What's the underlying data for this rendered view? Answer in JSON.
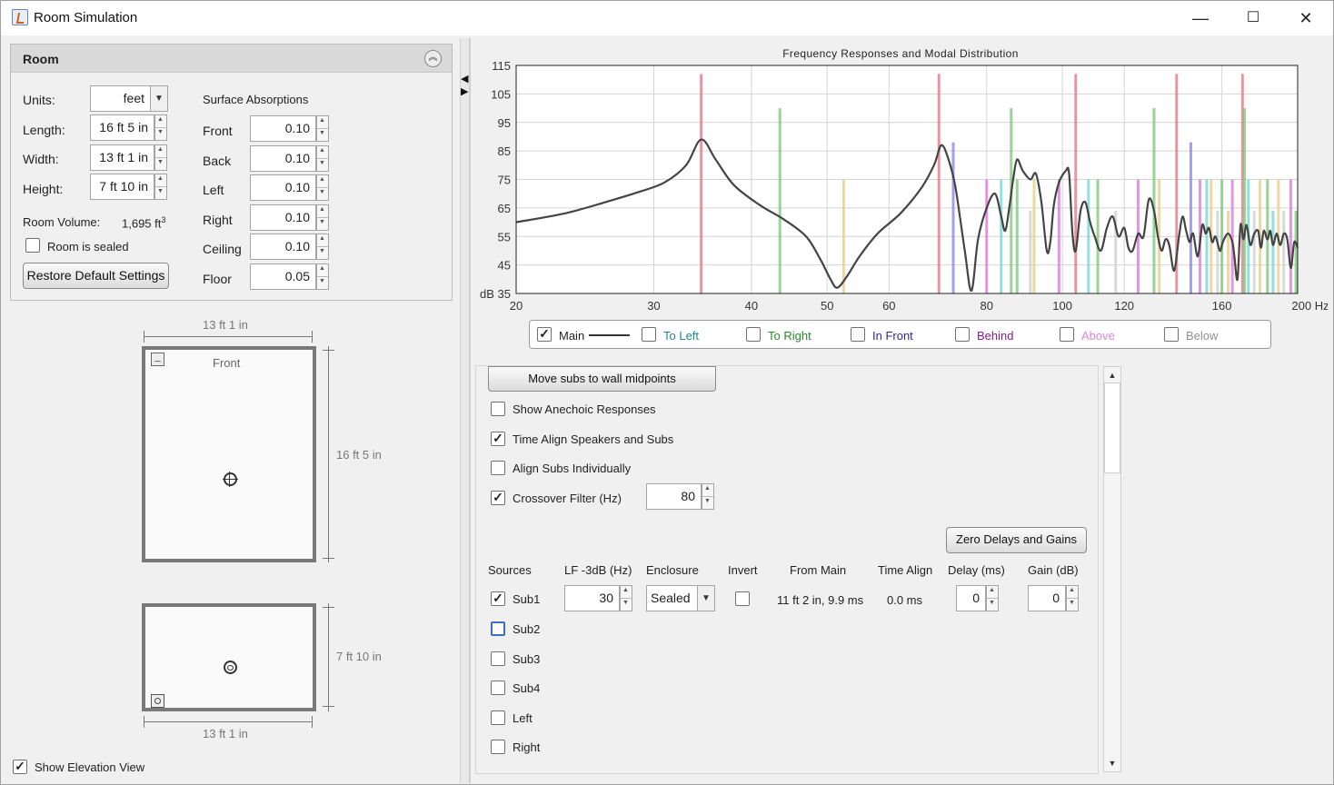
{
  "window": {
    "title": "Room Simulation",
    "minimize": "—",
    "maximize": "☐",
    "close": "✕"
  },
  "room": {
    "title": "Room",
    "units_label": "Units:",
    "units_value": "feet",
    "length_label": "Length:",
    "length_value": "16 ft 5 in",
    "width_label": "Width:",
    "width_value": "13 ft 1 in",
    "height_label": "Height:",
    "height_value": "7 ft 10 in",
    "volume_label": "Room Volume:",
    "volume_value": "1,695 ft",
    "volume_exp": "3",
    "sealed_label": "Room is sealed",
    "sealed_checked": false,
    "restore_label": "Restore Default Settings",
    "absorptions_title": "Surface Absorptions",
    "absorptions": [
      {
        "label": "Front",
        "value": "0.10"
      },
      {
        "label": "Back",
        "value": "0.10"
      },
      {
        "label": "Left",
        "value": "0.10"
      },
      {
        "label": "Right",
        "value": "0.10"
      },
      {
        "label": "Ceiling",
        "value": "0.10"
      },
      {
        "label": "Floor",
        "value": "0.05"
      }
    ]
  },
  "plan": {
    "top_dim": "13 ft 1 in",
    "side_dim": "16 ft 5 in",
    "front_label": "Front"
  },
  "elevation": {
    "side_dim": "7 ft 10 in",
    "bottom_dim": "13 ft 1 in"
  },
  "show_elevation": {
    "label": "Show Elevation View",
    "checked": true
  },
  "chart_data": {
    "type": "line",
    "title": "Frequency Responses and Modal Distribution",
    "x_scale": "log",
    "xlim": [
      20,
      200
    ],
    "ylim": [
      35,
      115
    ],
    "xticks": [
      "20",
      "30",
      "40",
      "50",
      "60",
      "80",
      "100",
      "120",
      "160",
      "200 Hz"
    ],
    "xtick_values": [
      20,
      30,
      40,
      50,
      60,
      80,
      100,
      120,
      160,
      200
    ],
    "yticks": [
      "115",
      "105",
      "95",
      "85",
      "75",
      "65",
      "55",
      "45",
      "dB 35"
    ],
    "ytick_values": [
      115,
      105,
      95,
      85,
      75,
      65,
      55,
      45,
      35
    ],
    "grid": true,
    "main_series": {
      "name": "Main",
      "color": "#444444",
      "points": [
        [
          20,
          60
        ],
        [
          23,
          63
        ],
        [
          26,
          67
        ],
        [
          29,
          71
        ],
        [
          31,
          74
        ],
        [
          33,
          80
        ],
        [
          34.5,
          89
        ],
        [
          36,
          82
        ],
        [
          38,
          73
        ],
        [
          41,
          66
        ],
        [
          44,
          61
        ],
        [
          47,
          55
        ],
        [
          49,
          47
        ],
        [
          50.5,
          40
        ],
        [
          51.5,
          37
        ],
        [
          53,
          41
        ],
        [
          55,
          48
        ],
        [
          58,
          56
        ],
        [
          62,
          63
        ],
        [
          66,
          72
        ],
        [
          68.5,
          80
        ],
        [
          70,
          87
        ],
        [
          71.5,
          82
        ],
        [
          73,
          72
        ],
        [
          75,
          50
        ],
        [
          76.5,
          36
        ],
        [
          78,
          54
        ],
        [
          80,
          65
        ],
        [
          82,
          70
        ],
        [
          83.5,
          62
        ],
        [
          84.5,
          57
        ],
        [
          85.5,
          65
        ],
        [
          86.5,
          75
        ],
        [
          87.5,
          82
        ],
        [
          89,
          78
        ],
        [
          91,
          75
        ],
        [
          92.5,
          77
        ],
        [
          94,
          67
        ],
        [
          95.5,
          50
        ],
        [
          96.5,
          53
        ],
        [
          97.5,
          66
        ],
        [
          99,
          74
        ],
        [
          101,
          78
        ],
        [
          102,
          77
        ],
        [
          103,
          56
        ],
        [
          104,
          50
        ],
        [
          105.5,
          64
        ],
        [
          107,
          67
        ],
        [
          108.5,
          60
        ],
        [
          110,
          55
        ],
        [
          112,
          50
        ],
        [
          114,
          58
        ],
        [
          116,
          62
        ],
        [
          118,
          55
        ],
        [
          120,
          58
        ],
        [
          121.5,
          51
        ],
        [
          123,
          50
        ],
        [
          125,
          56
        ],
        [
          127,
          55
        ],
        [
          129,
          68
        ],
        [
          131,
          64
        ],
        [
          132.5,
          55
        ],
        [
          134,
          50
        ],
        [
          135.5,
          54
        ],
        [
          137,
          52
        ],
        [
          139,
          43
        ],
        [
          141,
          55
        ],
        [
          142.5,
          62
        ],
        [
          144,
          57
        ],
        [
          145.5,
          53
        ],
        [
          147,
          56
        ],
        [
          149,
          48
        ],
        [
          151,
          59
        ],
        [
          152.5,
          56
        ],
        [
          154,
          58
        ],
        [
          155.5,
          53
        ],
        [
          157,
          55
        ],
        [
          159,
          50
        ],
        [
          160,
          52
        ],
        [
          161,
          54
        ],
        [
          163,
          56
        ],
        [
          165,
          53
        ],
        [
          166,
          48
        ],
        [
          167.5,
          40
        ],
        [
          169,
          59
        ],
        [
          170.5,
          54
        ],
        [
          172,
          59
        ],
        [
          174,
          52
        ],
        [
          176,
          56
        ],
        [
          178,
          57
        ],
        [
          179.5,
          51
        ],
        [
          181,
          57
        ],
        [
          183,
          54
        ],
        [
          184.5,
          57
        ],
        [
          186,
          52
        ],
        [
          188,
          56
        ],
        [
          190,
          52
        ],
        [
          192,
          56
        ],
        [
          194,
          54
        ],
        [
          196,
          44
        ],
        [
          198,
          53
        ],
        [
          200,
          51
        ]
      ]
    },
    "modes": [
      {
        "f": 34.5,
        "h": 112,
        "color": "#e07a8a"
      },
      {
        "f": 43.5,
        "h": 100,
        "color": "#7ec87e"
      },
      {
        "f": 52.5,
        "h": 75,
        "color": "#e6cf8a"
      },
      {
        "f": 69.5,
        "h": 112,
        "color": "#e07a8a"
      },
      {
        "f": 72.5,
        "h": 88,
        "color": "#8a8ae0"
      },
      {
        "f": 80,
        "h": 75,
        "color": "#e07ae0"
      },
      {
        "f": 83.5,
        "h": 75,
        "color": "#7ad6d6"
      },
      {
        "f": 86,
        "h": 100,
        "color": "#7ec87e"
      },
      {
        "f": 87.5,
        "h": 75,
        "color": "#7ec87e"
      },
      {
        "f": 91,
        "h": 64,
        "color": "#cfcfcf"
      },
      {
        "f": 92,
        "h": 75,
        "color": "#e6cf8a"
      },
      {
        "f": 99,
        "h": 75,
        "color": "#e07ae0"
      },
      {
        "f": 104,
        "h": 112,
        "color": "#e07a8a"
      },
      {
        "f": 108,
        "h": 75,
        "color": "#7ad6d6"
      },
      {
        "f": 111,
        "h": 75,
        "color": "#7ec87e"
      },
      {
        "f": 117,
        "h": 64,
        "color": "#cfcfcf"
      },
      {
        "f": 125,
        "h": 75,
        "color": "#e07ae0"
      },
      {
        "f": 131,
        "h": 100,
        "color": "#7ec87e"
      },
      {
        "f": 133,
        "h": 75,
        "color": "#e6cf8a"
      },
      {
        "f": 140,
        "h": 112,
        "color": "#e07a8a"
      },
      {
        "f": 146,
        "h": 88,
        "color": "#8a8ae0"
      },
      {
        "f": 150,
        "h": 75,
        "color": "#e07ae0"
      },
      {
        "f": 153,
        "h": 75,
        "color": "#7ad6d6"
      },
      {
        "f": 155,
        "h": 75,
        "color": "#e6cf8a"
      },
      {
        "f": 158,
        "h": 64,
        "color": "#cfcfcf"
      },
      {
        "f": 160,
        "h": 75,
        "color": "#7ec87e"
      },
      {
        "f": 163,
        "h": 64,
        "color": "#e6cf8a"
      },
      {
        "f": 165,
        "h": 75,
        "color": "#e07ae0"
      },
      {
        "f": 170,
        "h": 112,
        "color": "#e07a8a"
      },
      {
        "f": 171,
        "h": 100,
        "color": "#7ec87e"
      },
      {
        "f": 173,
        "h": 75,
        "color": "#7ad6d6"
      },
      {
        "f": 176,
        "h": 64,
        "color": "#cfcfcf"
      },
      {
        "f": 179,
        "h": 75,
        "color": "#e6cf8a"
      },
      {
        "f": 183,
        "h": 75,
        "color": "#7ec87e"
      },
      {
        "f": 186,
        "h": 64,
        "color": "#7ad6d6"
      },
      {
        "f": 189,
        "h": 75,
        "color": "#e6cf8a"
      },
      {
        "f": 192,
        "h": 64,
        "color": "#cfcfcf"
      },
      {
        "f": 196,
        "h": 75,
        "color": "#e07ae0"
      },
      {
        "f": 199,
        "h": 64,
        "color": "#7ec87e"
      }
    ]
  },
  "legend": [
    {
      "label": "Main",
      "checked": true,
      "color": "#222222"
    },
    {
      "label": "To Left",
      "checked": false,
      "color": "#1a8a8a"
    },
    {
      "label": "To Right",
      "checked": false,
      "color": "#2a8a2a"
    },
    {
      "label": "In Front",
      "checked": false,
      "color": "#2a2aa0"
    },
    {
      "label": "Behind",
      "checked": false,
      "color": "#8a1a8a"
    },
    {
      "label": "Above",
      "checked": false,
      "color": "#e080e0"
    },
    {
      "label": "Below",
      "checked": false,
      "color": "#909090"
    }
  ],
  "controls": {
    "move_subs_label": "Move subs to wall midpoints",
    "options": [
      {
        "label": "Show Anechoic Responses",
        "checked": false
      },
      {
        "label": "Time Align Speakers and Subs",
        "checked": true
      },
      {
        "label": "Align Subs Individually",
        "checked": false
      },
      {
        "label": "Crossover Filter (Hz)",
        "checked": true
      }
    ],
    "crossover_value": "80",
    "zero_label": "Zero Delays and Gains"
  },
  "sources": {
    "headers": [
      "Sources",
      "LF -3dB (Hz)",
      "Enclosure",
      "Invert",
      "From Main",
      "Time Align",
      "Delay (ms)",
      "Gain (dB)"
    ],
    "sub1": {
      "label": "Sub1",
      "checked": true,
      "lf": "30",
      "enclosure": "Sealed",
      "invert": false,
      "from_main": "11 ft 2 in, 9.9 ms",
      "time_align": "0.0 ms",
      "delay": "0",
      "gain": "0"
    },
    "others": [
      {
        "label": "Sub2",
        "checked": false
      },
      {
        "label": "Sub3",
        "checked": false
      },
      {
        "label": "Sub4",
        "checked": false
      },
      {
        "label": "Left",
        "checked": false
      },
      {
        "label": "Right",
        "checked": false
      }
    ]
  }
}
